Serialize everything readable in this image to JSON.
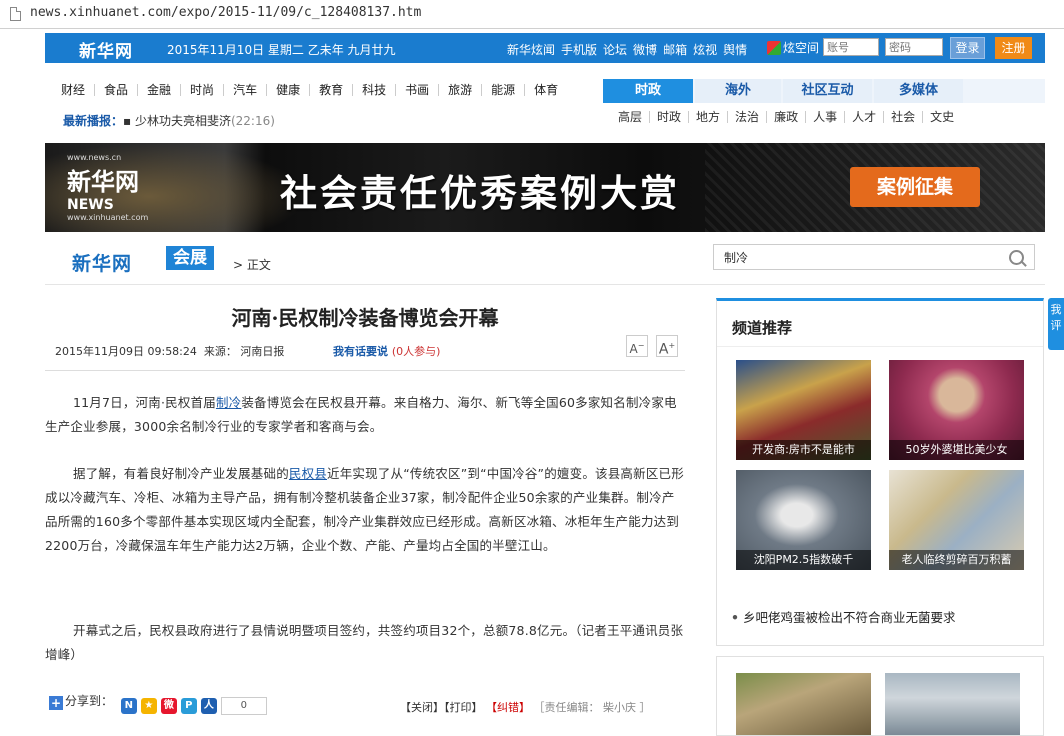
{
  "browser": {
    "url": "news.xinhuanet.com/expo/2015-11/09/c_128408137.htm"
  },
  "topbar": {
    "logo": "新华网",
    "date": "2015年11月10日  星期二    乙未年  九月廿九",
    "nav": [
      "新华炫闻",
      "手机版",
      "论坛",
      "微博",
      "邮箱",
      "炫视",
      "舆情"
    ],
    "space": "炫空间",
    "username_placeholder": "账号",
    "password_placeholder": "密码",
    "login": "登录",
    "register": "注册"
  },
  "channels": [
    "财经",
    "食品",
    "金融",
    "时尚",
    "汽车",
    "健康",
    "教育",
    "科技",
    "书画",
    "旅游",
    "能源",
    "体育"
  ],
  "latest": {
    "label": "最新播报：",
    "item": "▪ 少林功夫亮相斐济",
    "time": "(22:16)"
  },
  "tabs": [
    "时政",
    "海外",
    "社区互动",
    "多媒体"
  ],
  "subtabs": [
    "高层",
    "时政",
    "地方",
    "法治",
    "廉政",
    "人事",
    "人才",
    "社会",
    "文史"
  ],
  "banner": {
    "logo": "新华网",
    "logo_news": "NEWS",
    "logo_url": "www.news.cn",
    "logo_sub": "www.xinhuanet.com",
    "title": "社会责任优秀案例大赏",
    "badge": "案例征集"
  },
  "crumb": {
    "site": "新华网",
    "section": "会展",
    "current": "正文",
    "search_value": "制冷"
  },
  "article": {
    "title": "河南·民权制冷装备博览会开幕",
    "datetime": "2015年11月09日 09:58:24",
    "source_label": "来源：",
    "source": "河南日报",
    "comment_label": "我有话要说",
    "comment_count": "(0人参与)",
    "font_small": "A",
    "font_large": "A",
    "p1": [
      "11月7日，河南·民权首届",
      "制冷",
      "装备博览会在民权县开幕。来自格力、海尔、新飞等全国60多家知名制冷家电生产企业参展，3000余名制冷行业的专家学者和客商与会。"
    ],
    "p2": [
      "据了解，有着良好制冷产业发展基础的",
      "民权县",
      "近年实现了从“传统农区”到“中国冷谷”的嬗变。该县高新区已形成以冷藏汽车、冷柜、冰箱为主导产品，拥有制冷整机装备企业37家，制冷配件企业50余家的产业集群。制冷产品所需的160多个零部件基本实现区域内全配套，制冷产业集群效应已经形成。高新区冰箱、冰柜年生产能力达到2200万台，冷藏保温车年生产能力达2万辆，企业个数、产能、产量均占全国的半壁江山。"
    ],
    "p3": "开幕式之后，民权县政府进行了县情说明暨项目签约，共签约项目32个，总额78.8亿元。（记者王平通讯员张增峰）"
  },
  "share": {
    "label": "分享到：",
    "count": "0"
  },
  "tools": {
    "close": "【关闭】",
    "print": "【打印】",
    "error": "【纠错】",
    "editor": "［责任编辑： 柴小庆 ］"
  },
  "sidebar": {
    "heading": "频道推荐",
    "thumbs": [
      "开发商:房市不是能市",
      "50岁外婆堪比美少女",
      "沈阳PM2.5指数破千",
      "老人临终剪碎百万积蓄"
    ],
    "headline": "乡吧佬鸡蛋被检出不符合商业无菌要求",
    "float_tab": "我\n评"
  }
}
